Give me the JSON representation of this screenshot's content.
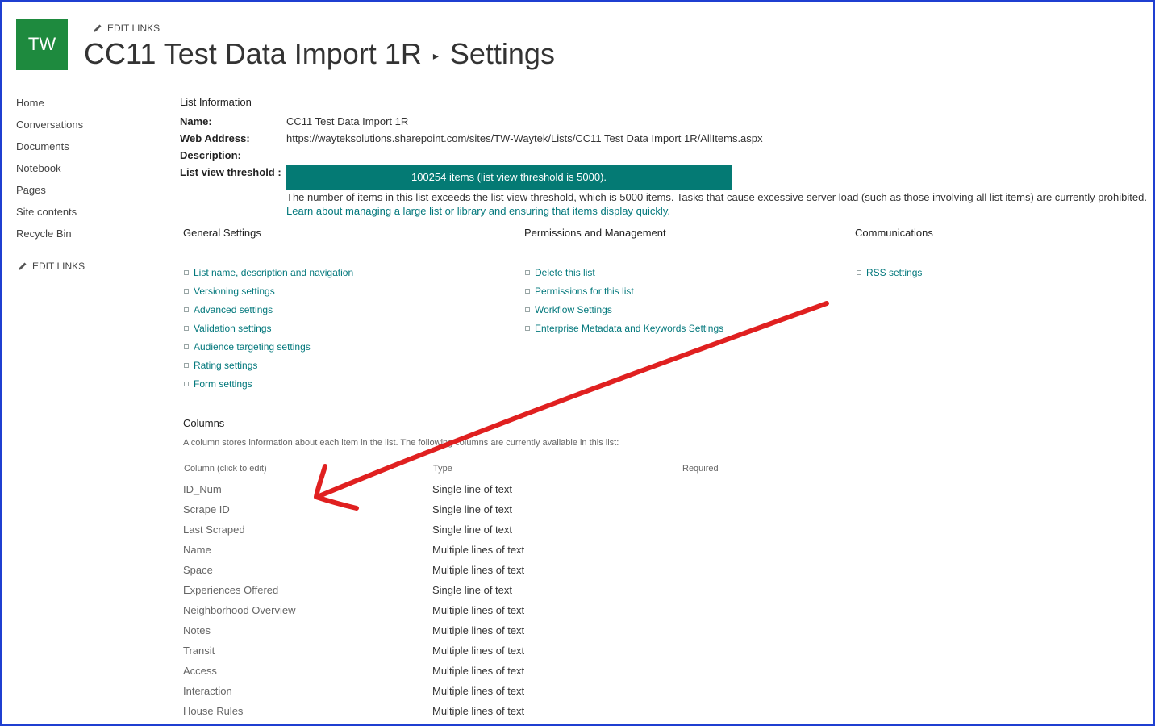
{
  "site": {
    "logo_text": "TW",
    "edit_links_label": "EDIT LINKS",
    "title": "CC11 Test Data Import 1R",
    "breadcrumb_separator": "▸",
    "page": "Settings",
    "brand_color": "#1e8a3e"
  },
  "leftnav": {
    "items": [
      {
        "label": "Home"
      },
      {
        "label": "Conversations"
      },
      {
        "label": "Documents"
      },
      {
        "label": "Notebook"
      },
      {
        "label": "Pages"
      },
      {
        "label": "Site contents"
      },
      {
        "label": "Recycle Bin"
      }
    ],
    "edit_links_label": "EDIT LINKS"
  },
  "list_info": {
    "heading": "List Information",
    "name_label": "Name:",
    "name_value": "CC11 Test Data Import 1R",
    "web_label": "Web Address:",
    "web_value": "https://wayteksolutions.sharepoint.com/sites/TW-Waytek/Lists/CC11 Test Data Import 1R/AllItems.aspx",
    "desc_label": "Description:",
    "threshold_label": "List view threshold :",
    "threshold_banner": "100254 items (list view threshold is 5000).",
    "threshold_message": "The number of items in this list exceeds the list view threshold, which is 5000 items. Tasks that cause excessive server load (such as those involving all list items) are currently prohibited.",
    "threshold_link": "Learn about managing a large list or library and ensuring that items display quickly.",
    "banner_color": "#047a74"
  },
  "general_settings": {
    "heading": "General Settings",
    "links": [
      {
        "label": "List name, description and navigation"
      },
      {
        "label": "Versioning settings"
      },
      {
        "label": "Advanced settings"
      },
      {
        "label": "Validation settings"
      },
      {
        "label": "Audience targeting settings"
      },
      {
        "label": "Rating settings"
      },
      {
        "label": "Form settings"
      }
    ]
  },
  "permissions": {
    "heading": "Permissions and Management",
    "links": [
      {
        "label": "Delete this list"
      },
      {
        "label": "Permissions for this list"
      },
      {
        "label": "Workflow Settings"
      },
      {
        "label": "Enterprise Metadata and Keywords Settings"
      }
    ]
  },
  "communications": {
    "heading": "Communications",
    "links": [
      {
        "label": "RSS settings"
      }
    ]
  },
  "columns": {
    "heading": "Columns",
    "description": "A column stores information about each item in the list. The following columns are currently available in this list:",
    "header_column": "Column (click to edit)",
    "header_type": "Type",
    "header_required": "Required",
    "rows": [
      {
        "name": "ID_Num",
        "type": "Single line of text"
      },
      {
        "name": "Scrape ID",
        "type": "Single line of text"
      },
      {
        "name": "Last Scraped",
        "type": "Single line of text"
      },
      {
        "name": "Name",
        "type": "Multiple lines of text"
      },
      {
        "name": "Space",
        "type": "Multiple lines of text"
      },
      {
        "name": "Experiences Offered",
        "type": "Single line of text"
      },
      {
        "name": "Neighborhood Overview",
        "type": "Multiple lines of text"
      },
      {
        "name": "Notes",
        "type": "Multiple lines of text"
      },
      {
        "name": "Transit",
        "type": "Multiple lines of text"
      },
      {
        "name": "Access",
        "type": "Multiple lines of text"
      },
      {
        "name": "Interaction",
        "type": "Multiple lines of text"
      },
      {
        "name": "House Rules",
        "type": "Multiple lines of text"
      }
    ]
  },
  "annotation": {
    "arrow_color": "#e02020"
  }
}
